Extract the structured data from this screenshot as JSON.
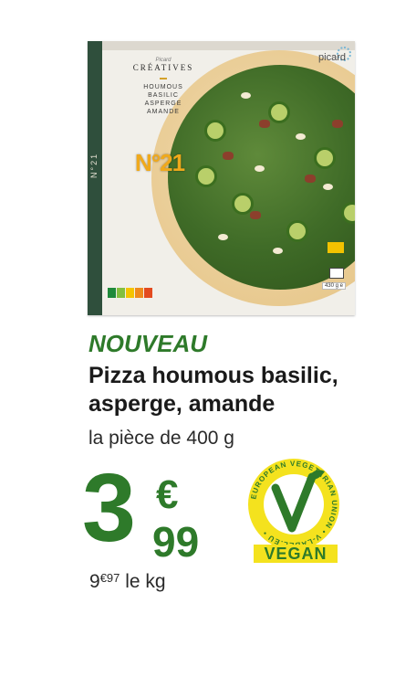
{
  "product_box": {
    "spine_text": "N°21",
    "brand_sub": "Picard",
    "brand_name": "CRÉATIVES",
    "recipe_lines": [
      "HOUMOUS",
      "BASILIC",
      "ASPERGE",
      "AMANDE"
    ],
    "number": "N°21",
    "retailer": "picard",
    "weight": "430 g e",
    "nutri_score": [
      "A",
      "B",
      "C",
      "D",
      "E"
    ]
  },
  "headline": "NOUVEAU",
  "title_line1": "Pizza houmous basilic,",
  "title_line2": "asperge, amande",
  "unit": "la pièce de 400 g",
  "price": {
    "integer": "3",
    "currency": "€",
    "decimals": "99"
  },
  "per_kg": {
    "euros": "9",
    "cents": "€97",
    "unit": "le kg"
  },
  "vlabel": {
    "ring_text": "EUROPEAN VEGETARIAN UNION • V-LABEL.EU •",
    "badge": "VEGAN"
  },
  "colors": {
    "brand_green": "#2e7a2a",
    "vegan_yellow": "#f4e21e",
    "numero_orange": "#f0a91b"
  }
}
